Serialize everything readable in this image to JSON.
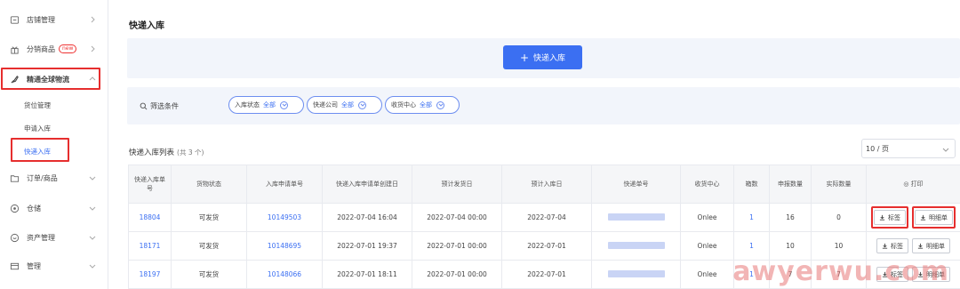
{
  "sidebar": {
    "items": [
      {
        "label": "店铺管理",
        "icon": "shop-icon"
      },
      {
        "label": "分销商品",
        "badge": "new",
        "icon": "gift-icon"
      },
      {
        "label": "精通全球物流",
        "icon": "rocket-icon"
      },
      {
        "label": "订单/商品",
        "icon": "folder-icon"
      },
      {
        "label": "仓储",
        "icon": "box-icon"
      },
      {
        "label": "资产管理",
        "icon": "wallet-icon"
      },
      {
        "label": "管理",
        "icon": "layers-icon"
      }
    ],
    "sub_items": [
      "货位管理",
      "申请入库",
      "快递入库"
    ]
  },
  "main": {
    "title": "快递入库",
    "primary_button": "快递入库",
    "filter": {
      "label": "筛选条件",
      "pills": [
        {
          "label": "入库状态",
          "value": "全部"
        },
        {
          "label": "快递公司",
          "value": "全部"
        },
        {
          "label": "收货中心",
          "value": "全部"
        }
      ]
    },
    "list_title": "快递入库列表",
    "list_count": "(共 3 个)",
    "page_size": "10 / 页",
    "table": {
      "headers": [
        "快递入库单号",
        "货物状态",
        "入库申请单号",
        "快递入库申请单创建日",
        "预计发货日",
        "预计入库日",
        "快递单号",
        "收货中心",
        "箱数",
        "申报数量",
        "实际数量",
        "打印"
      ],
      "rows": [
        {
          "id": "18804",
          "status": "可发货",
          "apply_no": "10149503",
          "created": "2022-07-04 16:04",
          "ship": "2022-07-04 00:00",
          "arrive": "2022-07-04",
          "center": "Onlee",
          "boxes": "1",
          "declared": "16",
          "actual": "0",
          "btn1": "标签",
          "btn2": "明细单"
        },
        {
          "id": "18171",
          "status": "可发货",
          "apply_no": "10148695",
          "created": "2022-07-01 19:37",
          "ship": "2022-07-01 00:00",
          "arrive": "2022-07-01",
          "center": "Onlee",
          "boxes": "1",
          "declared": "10",
          "actual": "10",
          "btn1": "标签",
          "btn2": "明细单"
        },
        {
          "id": "18197",
          "status": "可发货",
          "apply_no": "10148066",
          "created": "2022-07-01 18:11",
          "ship": "2022-07-01 00:00",
          "arrive": "2022-07-01",
          "center": "Onlee",
          "boxes": "1",
          "declared": "7",
          "actual": "7",
          "btn1": "标签",
          "btn2": "明细单"
        }
      ]
    }
  },
  "watermark": "awyerwu.com",
  "colors": {
    "accent": "#3b6ff2",
    "highlight": "#e62e2e",
    "watermark": "#e87878"
  }
}
